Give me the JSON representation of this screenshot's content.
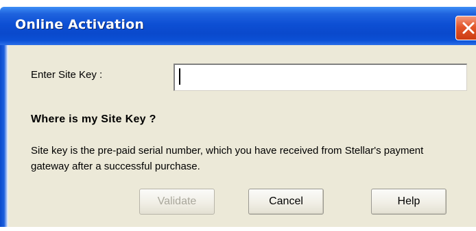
{
  "window": {
    "title": "Online Activation"
  },
  "form": {
    "site_key_label": "Enter Site Key :",
    "site_key_value": "",
    "heading": "Where is my Site Key ?",
    "description": "Site key is the pre-paid serial number, which you have received from Stellar's payment  gateway after a successful purchase."
  },
  "buttons": {
    "validate_label": "Validate",
    "cancel_label": "Cancel",
    "help_label": "Help"
  },
  "colors": {
    "titlebar_blue": "#0a49cc",
    "close_red": "#e2562b",
    "dialog_face": "#ece9d8"
  }
}
